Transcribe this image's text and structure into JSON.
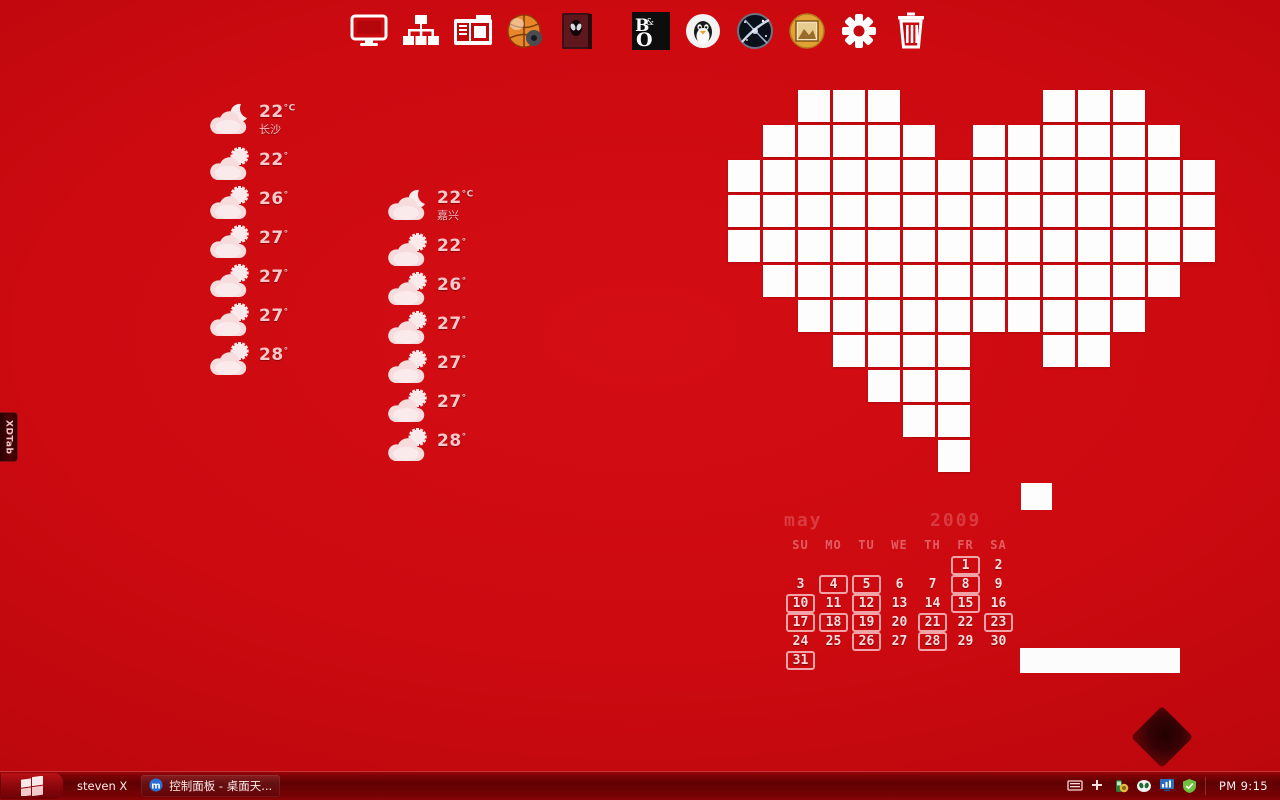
{
  "desktop": {
    "background_color": "#cc0a10",
    "accent_color": "#ffffff"
  },
  "dock": {
    "items": [
      {
        "name": "monitor-icon",
        "label": "Display"
      },
      {
        "name": "network-icon",
        "label": "Network"
      },
      {
        "name": "folder-windows-icon",
        "label": "Windows Explorer"
      },
      {
        "name": "basketball-icon",
        "label": "Media Player"
      },
      {
        "name": "alien-book-icon",
        "label": "Alienware"
      },
      {
        "name": "bang-olufsen-icon",
        "label": "B&O"
      },
      {
        "name": "penguin-icon",
        "label": "Linux"
      },
      {
        "name": "space-icon",
        "label": "Space"
      },
      {
        "name": "picture-frame-icon",
        "label": "Pictures"
      },
      {
        "name": "gear-icon",
        "label": "Settings"
      },
      {
        "name": "trash-icon",
        "label": "Recycle Bin"
      }
    ]
  },
  "weather_widgets": [
    {
      "id": "weather-changsha",
      "city": "长沙",
      "current_temp": "22",
      "current_unit": "°C",
      "current_icon": "moon-cloud-icon",
      "forecast": [
        {
          "icon": "sun-cloud-icon",
          "temp": "22",
          "unit": "°"
        },
        {
          "icon": "sun-cloud-icon",
          "temp": "26",
          "unit": "°"
        },
        {
          "icon": "sun-cloud-icon",
          "temp": "27",
          "unit": "°"
        },
        {
          "icon": "sun-cloud-icon",
          "temp": "27",
          "unit": "°"
        },
        {
          "icon": "sun-cloud-icon",
          "temp": "27",
          "unit": "°"
        },
        {
          "icon": "sun-cloud-icon",
          "temp": "28",
          "unit": "°"
        }
      ]
    },
    {
      "id": "weather-jiaxing",
      "city": "嘉兴",
      "current_temp": "22",
      "current_unit": "°C",
      "current_icon": "moon-cloud-icon",
      "forecast": [
        {
          "icon": "sun-cloud-icon",
          "temp": "22",
          "unit": "°"
        },
        {
          "icon": "sun-cloud-icon",
          "temp": "26",
          "unit": "°"
        },
        {
          "icon": "sun-cloud-icon",
          "temp": "27",
          "unit": "°"
        },
        {
          "icon": "sun-cloud-icon",
          "temp": "27",
          "unit": "°"
        },
        {
          "icon": "sun-cloud-icon",
          "temp": "27",
          "unit": "°"
        },
        {
          "icon": "sun-cloud-icon",
          "temp": "28",
          "unit": "°"
        }
      ]
    }
  ],
  "heart_wallpaper": {
    "name": "pixel-heart",
    "cell_size": 32,
    "cell_pitch": 35,
    "color": "#fdfdfd",
    "rows": [
      [
        0,
        0,
        1,
        1,
        1,
        0,
        0,
        0,
        0,
        1,
        1,
        1,
        0,
        0
      ],
      [
        0,
        1,
        1,
        1,
        1,
        1,
        0,
        1,
        1,
        1,
        1,
        1,
        1,
        0
      ],
      [
        1,
        1,
        1,
        1,
        1,
        1,
        1,
        1,
        1,
        1,
        1,
        1,
        1,
        1
      ],
      [
        1,
        1,
        1,
        1,
        1,
        1,
        1,
        1,
        1,
        1,
        1,
        1,
        1,
        1
      ],
      [
        1,
        1,
        1,
        1,
        1,
        1,
        1,
        1,
        1,
        1,
        1,
        1,
        1,
        1
      ],
      [
        0,
        1,
        1,
        1,
        1,
        1,
        1,
        1,
        1,
        1,
        1,
        1,
        1,
        0
      ],
      [
        0,
        0,
        1,
        1,
        1,
        1,
        1,
        1,
        1,
        1,
        1,
        1,
        0,
        0
      ],
      [
        0,
        0,
        0,
        1,
        1,
        1,
        1,
        0,
        0,
        1,
        1,
        0,
        0,
        0
      ],
      [
        0,
        0,
        0,
        0,
        1,
        1,
        1,
        0,
        0,
        0,
        0,
        0,
        0,
        0
      ],
      [
        0,
        0,
        0,
        0,
        0,
        1,
        1,
        0,
        0,
        0,
        0,
        0,
        0,
        0
      ],
      [
        0,
        0,
        0,
        0,
        0,
        0,
        1,
        0,
        0,
        0,
        0,
        0,
        0,
        0
      ]
    ]
  },
  "calendar": {
    "month": "may",
    "year": "2009",
    "dow": [
      "SU",
      "MO",
      "TU",
      "WE",
      "TH",
      "FR",
      "SA"
    ],
    "lead_blanks": 5,
    "days": [
      {
        "n": "1",
        "marked": true
      },
      {
        "n": "2",
        "marked": false
      },
      {
        "n": "3",
        "marked": false
      },
      {
        "n": "4",
        "marked": true
      },
      {
        "n": "5",
        "marked": true
      },
      {
        "n": "6",
        "marked": false
      },
      {
        "n": "7",
        "marked": false
      },
      {
        "n": "8",
        "marked": true
      },
      {
        "n": "9",
        "marked": false
      },
      {
        "n": "10",
        "marked": true
      },
      {
        "n": "11",
        "marked": false
      },
      {
        "n": "12",
        "marked": true
      },
      {
        "n": "13",
        "marked": false
      },
      {
        "n": "14",
        "marked": false
      },
      {
        "n": "15",
        "marked": true
      },
      {
        "n": "16",
        "marked": false
      },
      {
        "n": "17",
        "marked": true
      },
      {
        "n": "18",
        "marked": true
      },
      {
        "n": "19",
        "marked": true
      },
      {
        "n": "20",
        "marked": false
      },
      {
        "n": "21",
        "marked": true
      },
      {
        "n": "22",
        "marked": false
      },
      {
        "n": "23",
        "marked": true
      },
      {
        "n": "24",
        "marked": false
      },
      {
        "n": "25",
        "marked": false
      },
      {
        "n": "26",
        "marked": true
      },
      {
        "n": "27",
        "marked": false
      },
      {
        "n": "28",
        "marked": true
      },
      {
        "n": "29",
        "marked": false
      },
      {
        "n": "30",
        "marked": false
      },
      {
        "n": "31",
        "marked": true
      }
    ]
  },
  "side_tab": {
    "label": "XDTab"
  },
  "taskbar": {
    "start_label": "Start",
    "buttons": [
      {
        "name": "taskbar-item-steven",
        "label": "steven X",
        "icon": null,
        "active": false
      },
      {
        "name": "taskbar-item-control-panel",
        "label": "控制面板 - 桌面天...",
        "icon": "maxthon-icon",
        "active": true
      }
    ],
    "tray": {
      "icons": [
        {
          "name": "keyboard-icon"
        },
        {
          "name": "plus-icon"
        },
        {
          "name": "security-icon"
        },
        {
          "name": "alien-face-icon"
        },
        {
          "name": "monitor-chart-icon"
        },
        {
          "name": "shield-green-icon"
        }
      ],
      "clock": "PM 9:15"
    }
  }
}
